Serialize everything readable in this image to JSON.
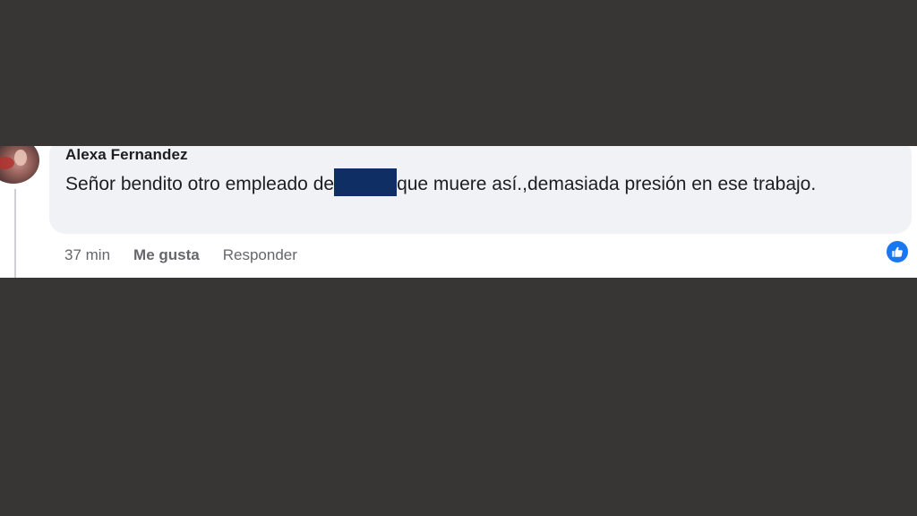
{
  "comment": {
    "author": "Alexa Fernandez",
    "text_before": "Señor bendito otro empleado de",
    "text_after": "que muere así.,demasiada presión en ese trabajo.",
    "timestamp": "37 min",
    "like_label": "Me gusta",
    "reply_label": "Responder",
    "reaction_icon": "like-reaction-icon"
  },
  "colors": {
    "background": "#383635",
    "bubble": "#f0f2f5",
    "text": "#1c1e21",
    "secondary_text": "#65676b",
    "redaction": "#0f2e63",
    "reaction_blue": "#1877f2"
  }
}
